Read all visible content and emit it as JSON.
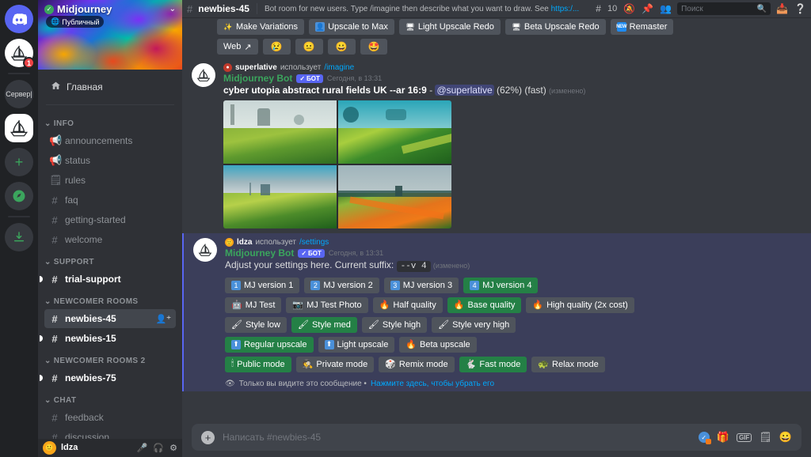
{
  "rail": {
    "items": [
      {
        "name": "discord-home",
        "icon": "discord-logo",
        "pill": "none",
        "badge": ""
      },
      {
        "name": "midjourney-server-1",
        "icon": "sailboat",
        "pill": "sm",
        "badge": "1"
      },
      {
        "name": "server-label",
        "icon": "",
        "label": "Сервер|",
        "pill": "sm",
        "badge": ""
      },
      {
        "name": "midjourney-server-selected",
        "icon": "sailboat",
        "pill": "lg",
        "badge": ""
      },
      {
        "name": "add-server",
        "icon": "plus",
        "pill": "none",
        "badge": ""
      },
      {
        "name": "explore-servers",
        "icon": "compass",
        "pill": "none",
        "badge": ""
      },
      {
        "name": "download-apps",
        "icon": "download",
        "pill": "none",
        "badge": ""
      }
    ]
  },
  "sidebar": {
    "server_name": "Midjourney",
    "public_badge": "Публичный",
    "home_label": "Главная",
    "categories": [
      {
        "label": "INFO",
        "channels": [
          {
            "name": "announcements",
            "icon": "announcement",
            "state": "muted"
          },
          {
            "name": "status",
            "icon": "announcement",
            "state": "muted"
          },
          {
            "name": "rules",
            "icon": "rules",
            "state": "muted"
          },
          {
            "name": "faq",
            "icon": "hash",
            "state": "muted"
          },
          {
            "name": "getting-started",
            "icon": "hash",
            "state": "muted"
          },
          {
            "name": "welcome",
            "icon": "hash",
            "state": "muted"
          }
        ]
      },
      {
        "label": "SUPPORT",
        "channels": [
          {
            "name": "trial-support",
            "icon": "hash",
            "state": "unread"
          }
        ]
      },
      {
        "label": "NEWCOMER ROOMS",
        "channels": [
          {
            "name": "newbies-45",
            "icon": "hash-thread",
            "state": "active",
            "trailing": "invite"
          },
          {
            "name": "newbies-15",
            "icon": "hash-thread",
            "state": "unread"
          }
        ]
      },
      {
        "label": "NEWCOMER ROOMS 2",
        "channels": [
          {
            "name": "newbies-75",
            "icon": "hash-thread",
            "state": "unread"
          }
        ]
      },
      {
        "label": "CHAT",
        "channels": [
          {
            "name": "feedback",
            "icon": "hash",
            "state": "muted"
          },
          {
            "name": "discussion",
            "icon": "hash-thread",
            "state": "muted"
          }
        ]
      }
    ],
    "user": {
      "name": "ldza",
      "icons": [
        "mic-muted-icon",
        "headphones-icon",
        "gear-icon"
      ]
    }
  },
  "topbar": {
    "channel": "newbies-45",
    "topic_text": "Bot room for new users. Type /imagine then describe what you want to draw. See ",
    "topic_link": "https:/...",
    "member_count": "10",
    "search_placeholder": "Поиск",
    "icons": [
      "threads-icon",
      "notification-off-icon",
      "pinned-icon",
      "members-icon",
      "inbox-icon",
      "help-icon"
    ]
  },
  "message_top": {
    "action_buttons": [
      {
        "label": "Make Variations",
        "icon": "sparkles",
        "style": "grey"
      },
      {
        "label": "Upscale to Max",
        "icon": "blue-person",
        "style": "grey"
      },
      {
        "label": "Light Upscale Redo",
        "icon": "monitor",
        "style": "grey"
      },
      {
        "label": "Beta Upscale Redo",
        "icon": "monitor",
        "style": "grey"
      },
      {
        "label": "Remaster",
        "icon": "new-badge",
        "style": "grey"
      }
    ],
    "second_row": [
      {
        "label": "Web",
        "icon": "external-link",
        "style": "grey"
      },
      {
        "label": "",
        "icon": "😢",
        "style": "grey"
      },
      {
        "label": "",
        "icon": "😐",
        "style": "grey"
      },
      {
        "label": "",
        "icon": "😀",
        "style": "grey"
      },
      {
        "label": "",
        "icon": "🤩",
        "style": "grey"
      }
    ]
  },
  "message_imagine": {
    "command_user": "superlative",
    "command_verb": "использует",
    "command_name": "/imagine",
    "bot_name": "Midjourney Bot",
    "bot_tag": "БОТ",
    "timestamp": "Сегодня, в 13:31",
    "prompt": "cyber utopia abstract rural fields UK --ar 16:9",
    "separator": "-",
    "mention": "@superlative",
    "progress": "(62%)",
    "mode": "(fast)",
    "edited": "(изменено)"
  },
  "message_settings": {
    "command_user": "ldza",
    "command_verb": "использует",
    "command_name": "/settings",
    "bot_name": "Midjourney Bot",
    "bot_tag": "БОТ",
    "timestamp": "Сегодня, в 13:31",
    "text": "Adjust your settings here. Current suffix:",
    "suffix_code": "--v 4",
    "edited": "(изменено)",
    "rows": [
      [
        {
          "label": "MJ version 1",
          "icon": "1",
          "icon_kind": "number",
          "style": "grey"
        },
        {
          "label": "MJ version 2",
          "icon": "2",
          "icon_kind": "number",
          "style": "grey"
        },
        {
          "label": "MJ version 3",
          "icon": "3",
          "icon_kind": "number",
          "style": "grey"
        },
        {
          "label": "MJ version 4",
          "icon": "4",
          "icon_kind": "number",
          "style": "green"
        }
      ],
      [
        {
          "label": "MJ Test",
          "icon": "🤖",
          "icon_kind": "emoji",
          "style": "grey"
        },
        {
          "label": "MJ Test Photo",
          "icon": "📷",
          "icon_kind": "emoji",
          "style": "grey"
        },
        {
          "label": "Half quality",
          "icon": "🔥",
          "icon_kind": "emoji",
          "style": "grey"
        },
        {
          "label": "Base quality",
          "icon": "🔥",
          "icon_kind": "emoji",
          "style": "green"
        },
        {
          "label": "High quality (2x cost)",
          "icon": "🔥",
          "icon_kind": "emoji",
          "style": "grey"
        }
      ],
      [
        {
          "label": "Style low",
          "icon": "🖌",
          "icon_kind": "emoji",
          "style": "grey"
        },
        {
          "label": "Style med",
          "icon": "🖌",
          "icon_kind": "emoji",
          "style": "green"
        },
        {
          "label": "Style high",
          "icon": "🖌",
          "icon_kind": "emoji",
          "style": "grey"
        },
        {
          "label": "Style very high",
          "icon": "🖌",
          "icon_kind": "emoji",
          "style": "grey"
        }
      ],
      [
        {
          "label": "Regular upscale",
          "icon": "⬆",
          "icon_kind": "blue",
          "style": "green"
        },
        {
          "label": "Light upscale",
          "icon": "⬆",
          "icon_kind": "blue",
          "style": "grey"
        },
        {
          "label": "Beta upscale",
          "icon": "🔥",
          "icon_kind": "emoji",
          "style": "grey"
        }
      ],
      [
        {
          "label": "Public mode",
          "icon": "🕯",
          "icon_kind": "emoji",
          "style": "green"
        },
        {
          "label": "Private mode",
          "icon": "🕵",
          "icon_kind": "emoji",
          "style": "grey"
        },
        {
          "label": "Remix mode",
          "icon": "🎲",
          "icon_kind": "emoji",
          "style": "grey"
        },
        {
          "label": "Fast mode",
          "icon": "🐇",
          "icon_kind": "emoji",
          "style": "green"
        },
        {
          "label": "Relax mode",
          "icon": "🐢",
          "icon_kind": "emoji",
          "style": "grey"
        }
      ]
    ],
    "ephemeral_note": "Только вы видите это сообщение •",
    "ephemeral_link": "Нажмите здесь, чтобы убрать его"
  },
  "composer": {
    "placeholder": "Написать #newbies-45",
    "icons": [
      "nitro-icon",
      "gift-icon",
      "gif-icon",
      "sticker-icon",
      "emoji-icon"
    ]
  },
  "colors": {
    "accent_green": "#248046",
    "blurple": "#5865f2",
    "link_blue": "#00a8fc",
    "bot_green": "#3ba55d",
    "badge_red": "#ed4245"
  }
}
